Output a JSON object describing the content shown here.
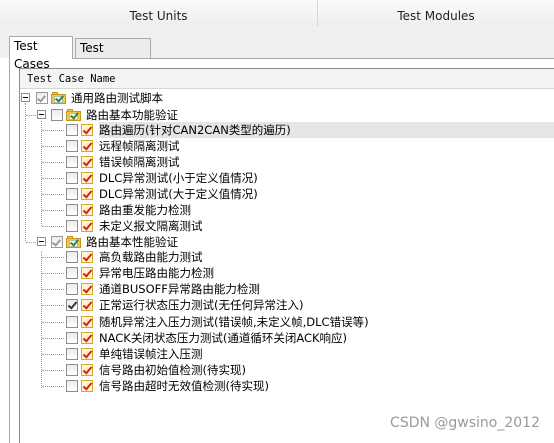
{
  "header": {
    "units_tab": "Test Units",
    "modules_tab": "Test Modules"
  },
  "tabs": {
    "cases": "Test Cases",
    "observer": "Test Observer"
  },
  "column_header": "Test Case Name",
  "root": {
    "label": "通用路由测试脚本",
    "checked": "partial"
  },
  "group1": {
    "label": "路由基本功能验证",
    "items": [
      {
        "label": "路由遍历(针对CAN2CAN类型的遍历)",
        "checked": false,
        "selected": true
      },
      {
        "label": "远程帧隔离测试",
        "checked": false
      },
      {
        "label": "错误帧隔离测试",
        "checked": false
      },
      {
        "label": "DLC异常测试(小于定义值情况)",
        "checked": false
      },
      {
        "label": "DLC异常测试(大于定义值情况)",
        "checked": false
      },
      {
        "label": "路由重发能力检测",
        "checked": false
      },
      {
        "label": "未定义报文隔离测试",
        "checked": false
      }
    ]
  },
  "group2": {
    "label": "路由基本性能验证",
    "items": [
      {
        "label": "高负载路由能力测试",
        "checked": false
      },
      {
        "label": "异常电压路由能力检测",
        "checked": false
      },
      {
        "label": "通道BUSOFF异常路由能力检测",
        "checked": false
      },
      {
        "label": "正常运行状态压力测试(无任何异常注入)",
        "checked": true
      },
      {
        "label": "随机异常注入压力测试(错误帧,未定义帧,DLC错误等)",
        "checked": false
      },
      {
        "label": "NACK关闭状态压力测试(通道循环关闭ACK响应)",
        "checked": false
      },
      {
        "label": "单纯错误帧注入压测",
        "checked": false
      },
      {
        "label": "信号路由初始值检测(待实现)",
        "checked": false
      },
      {
        "label": "信号路由超时无效值检测(待实现)",
        "checked": false
      }
    ]
  },
  "watermark": "CSDN @gwsino_2012"
}
